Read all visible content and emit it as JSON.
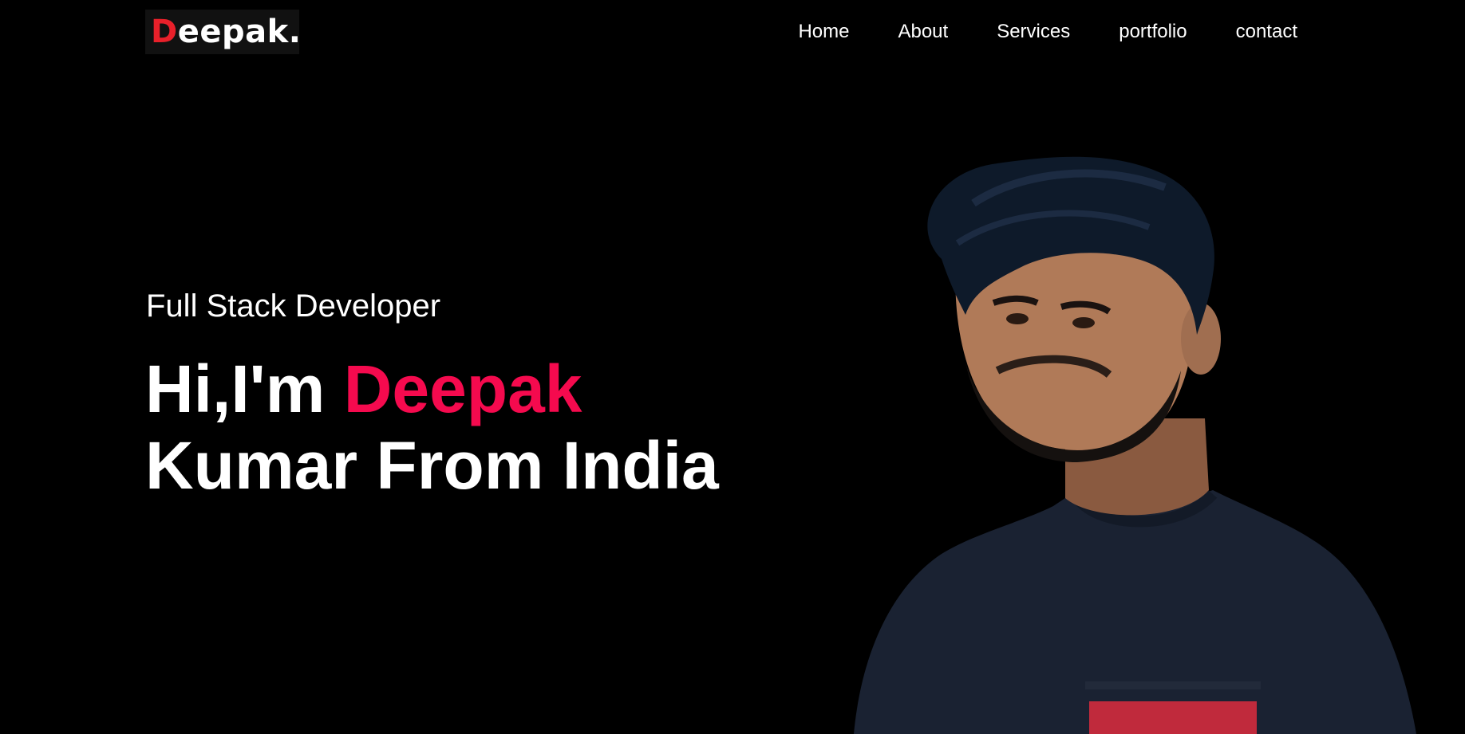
{
  "logo": {
    "first_letter": "D",
    "rest": "eepak."
  },
  "nav": {
    "items": [
      {
        "label": "Home"
      },
      {
        "label": "About"
      },
      {
        "label": "Services"
      },
      {
        "label": "portfolio"
      },
      {
        "label": "contact"
      }
    ]
  },
  "hero": {
    "subtitle": "Full Stack Developer",
    "greeting": "Hi,I'm",
    "name_highlight": "Deepak",
    "line2": "Kumar From India",
    "portrait_icon": "person-portrait-icon"
  },
  "colors": {
    "background": "#000000",
    "accent": "#f50a4e",
    "logo_accent": "#e8202a",
    "text": "#ffffff"
  }
}
